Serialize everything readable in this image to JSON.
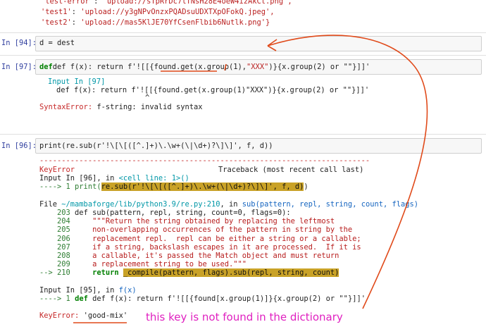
{
  "top_output": {
    "line1_key": "'test-error'",
    "line1_val": "'upload://sTpRrDc7lTNsH28E4oeW4izAkCt.png',",
    "line2_key": "'test1'",
    "line2_val": "'upload://y3gNPvOnzxPQADsuUDXTXpOFokQ.jpeg',",
    "line3_key": "'test2'",
    "line3_val": "'upload://mas5KlJE70YfCsenFlbib6Nutlk.png'}"
  },
  "cell94": {
    "prompt": "In [94]:",
    "code": "d = dest"
  },
  "cell97": {
    "prompt": "In [97]:",
    "code_a": "def f(x): return f'![[{found.get(x.group(1),",
    "code_b": "\"XXX\"",
    "code_c": ")}{x.group(2) or \"\"}]]'",
    "err_input": "Input In [97]",
    "err_code": "def f(x): return f'![[{found.get(x.group(1)\"XXX\")}{x.group(2) or \"\"}]]'",
    "err_caret": "^",
    "err_name": "SyntaxError:",
    "err_msg": "f-string: invalid syntax"
  },
  "cell96": {
    "prompt": "In [96]:",
    "code": "print(re.sub(r'!\\[\\[([^.]+)\\.\\w+(\\|\\d+)?\\]\\]', f, d))",
    "dashes": "---------------------------------------------------------------------------",
    "tb_err": "KeyError",
    "tb_header": "Traceback (most recent call last)",
    "tb_input": "Input In [96], in",
    "tb_cell": "<cell line: 1>()",
    "tb_arrow1": "----> 1 print(",
    "tb_hl1": "re.sub(r'!\\[\\[([^.]+)\\.\\w+(\\|\\d+)?\\]\\]', f, d)",
    "tb_close1": ")",
    "file_prefix": "File ",
    "file_path": "~/mambaforge/lib/python3.9/re.py:210",
    "file_in": ", in",
    "file_func": "sub(pattern, repl, string, count, flags)",
    "lines": [
      {
        "num": "203",
        "text": "def sub(pattern, repl, string, count=0, flags=0):"
      },
      {
        "num": "204",
        "text": "    \"\"\"Return the string obtained by replacing the leftmost"
      },
      {
        "num": "205",
        "text": "    non-overlapping occurrences of the pattern in string by the"
      },
      {
        "num": "206",
        "text": "    replacement repl.  repl can be either a string or a callable;"
      },
      {
        "num": "207",
        "text": "    if a string, backslash escapes in it are processed.  If it is"
      },
      {
        "num": "208",
        "text": "    a callable, it's passed the Match object and must return"
      },
      {
        "num": "209",
        "text": "    a replacement string to be used.\"\"\""
      }
    ],
    "arrow210": "--> 210",
    "line210_kw": "return",
    "line210_hl": "_compile(pattern, flags).sub(repl, string, count)",
    "input95": "Input In [95], in",
    "input95_func": "f(x)",
    "arrow95": "----> 1",
    "line95": "def f(x): return f'![[{found[x.group(1)]}{x.group(2) or \"\"}]]'",
    "final_err": "KeyError:",
    "final_key": "'good-mix'"
  },
  "annotation": "this key is not found in the dictionary"
}
